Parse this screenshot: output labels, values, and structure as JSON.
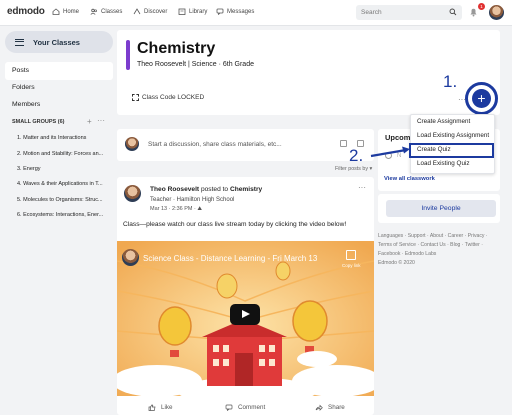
{
  "nav": {
    "logo": "edmodo",
    "items": [
      {
        "label": "Home",
        "icon": "home-icon"
      },
      {
        "label": "Classes",
        "icon": "classes-icon"
      },
      {
        "label": "Discover",
        "icon": "discover-icon"
      },
      {
        "label": "Library",
        "icon": "library-icon"
      },
      {
        "label": "Messages",
        "icon": "messages-icon"
      }
    ],
    "search_placeholder": "Search",
    "notification_count": "1"
  },
  "sidebar": {
    "your_classes": "Your Classes",
    "links": [
      "Posts",
      "Folders",
      "Members"
    ],
    "small_groups_label": "SMALL GROUPS (6)",
    "small_groups": [
      "1. Matter and its Interactions",
      "2. Motion and Stability: Forces an...",
      "3. Energy",
      "4. Waves & their Applications in T...",
      "5. Molecules to Organisms: Struc...",
      "6. Ecosystems: Interactions, Ener..."
    ]
  },
  "class": {
    "title": "Chemistry",
    "subtitle": "Theo Roosevelt | Science  · 6th Grade",
    "code_label": "Class Code LOCKED",
    "accent_color": "#7c3cce"
  },
  "annotations": {
    "step1": "1.",
    "step2": "2.",
    "color": "#1c3a9f"
  },
  "create_menu": {
    "plus_label": "+",
    "items": [
      "Create Assignment",
      "Load Existing Assignment",
      "Create Quiz",
      "Load Existing Quiz"
    ]
  },
  "composer": {
    "placeholder": "Start a discussion, share class materials, etc...",
    "filter_label": "Filter posts by ▾"
  },
  "upcoming": {
    "title": "Upcomi",
    "item": "N",
    "view_all": "View all classwork",
    "invite": "Invite People"
  },
  "footer": {
    "line1": "Languages · Support · About · Career · Privacy ·",
    "line2": "Terms of Service · Contact Us · Blog · Twitter ·",
    "line3": "Facebook · Edmodo Labs",
    "line4": "Edmodo © 2020"
  },
  "post": {
    "author": "Theo Roosevelt",
    "posted_to": "posted to",
    "class": "Chemistry",
    "role": "Teacher · Hamilton High School",
    "date": "Mar 13 · 2:36 PM ·",
    "body": "Class—please watch our class live stream today by clicking the video below!",
    "video_title": "Science Class - Distance Learning - Fri March 13",
    "video_copy_label": "Copy link",
    "actions": [
      "Like",
      "Comment",
      "Share"
    ]
  }
}
